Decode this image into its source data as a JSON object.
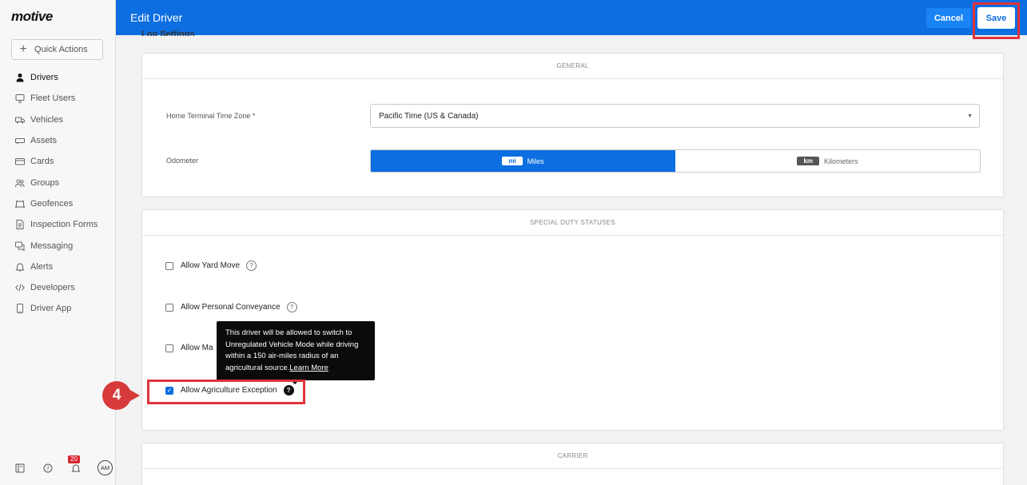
{
  "brand": {
    "logo": "motive"
  },
  "sidebar": {
    "quick_actions": "Quick Actions",
    "items": [
      {
        "label": "Drivers",
        "icon": "person-icon",
        "active": true
      },
      {
        "label": "Fleet Users",
        "icon": "monitor-icon"
      },
      {
        "label": "Vehicles",
        "icon": "truck-icon"
      },
      {
        "label": "Assets",
        "icon": "trailer-icon"
      },
      {
        "label": "Cards",
        "icon": "card-icon"
      },
      {
        "label": "Groups",
        "icon": "group-icon"
      },
      {
        "label": "Geofences",
        "icon": "geofence-icon"
      },
      {
        "label": "Inspection Forms",
        "icon": "document-icon"
      },
      {
        "label": "Messaging",
        "icon": "chat-icon"
      },
      {
        "label": "Alerts",
        "icon": "bell-icon"
      },
      {
        "label": "Developers",
        "icon": "code-icon"
      },
      {
        "label": "Driver App",
        "icon": "phone-icon"
      }
    ],
    "bottom": {
      "notification_count": "20",
      "avatar_initials": "AM"
    }
  },
  "header": {
    "title": "Edit Driver",
    "cancel_label": "Cancel",
    "save_label": "Save"
  },
  "content": {
    "section_title": "Log Settings",
    "general": {
      "heading": "GENERAL",
      "timezone_label": "Home Terminal Time Zone *",
      "timezone_value": "Pacific Time (US & Canada)",
      "odometer_label": "Odometer",
      "odometer_options": [
        {
          "unit": "mi",
          "label": "Miles",
          "selected": true
        },
        {
          "unit": "km",
          "label": "Kilometers",
          "selected": false
        }
      ]
    },
    "special_duty": {
      "heading": "SPECIAL DUTY STATUSES",
      "options": [
        {
          "label": "Allow Yard Move",
          "checked": false
        },
        {
          "label": "Allow Personal Conveyance",
          "checked": false
        },
        {
          "label": "Allow Ma",
          "checked": false
        },
        {
          "label": "Allow Agriculture Exception",
          "checked": true
        }
      ]
    },
    "tooltip": {
      "text": "This driver will be allowed to switch to Unregulated Vehicle Mode while driving within a 150 air-miles radius of an agricultural source.",
      "link": "Learn More"
    },
    "carrier": {
      "heading": "CARRIER"
    }
  },
  "annotation": {
    "step": "4"
  },
  "colors": {
    "primary": "#0c6ee0",
    "highlight": "#e0333c",
    "marker": "#d63a3a"
  }
}
